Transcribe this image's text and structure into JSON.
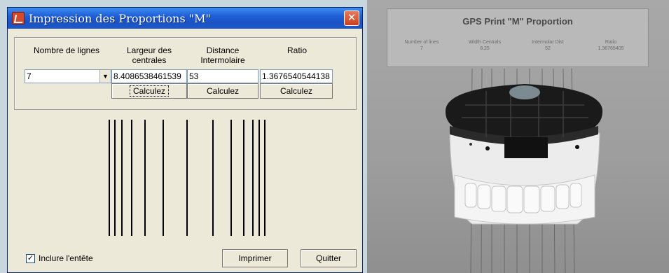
{
  "dialog": {
    "title": "Impression des Proportions \"M\"",
    "close_label": "✕",
    "headers": {
      "lines": "Nombre de lignes",
      "width_line1": "Largeur des",
      "width_line2": "centrales",
      "distance_line1": "Distance",
      "distance_line2": "Intermolaire",
      "ratio": "Ratio"
    },
    "fields": {
      "lines_value": "7",
      "width_value": "8.4086538461539",
      "distance_value": "53",
      "ratio_value": "1.3676540544138"
    },
    "calc_label": "Calculez",
    "include_header_label": "Inclure l'entête",
    "include_header_checked": true,
    "print_label": "Imprimer",
    "quit_label": "Quitter"
  },
  "photo": {
    "sheet_title": "GPS Print \"M\" Proportion",
    "columns": [
      {
        "label": "Number of lines",
        "value": "7"
      },
      {
        "label": "Width Centrals",
        "value": "8.25"
      },
      {
        "label": "Intermolar Dist",
        "value": "52"
      },
      {
        "label": "Ratio",
        "value": "1.36765405"
      }
    ]
  },
  "colors": {
    "title_bar": "#1f5fd6",
    "dialog_bg": "#ece9d8",
    "close_button": "#c8401e"
  }
}
